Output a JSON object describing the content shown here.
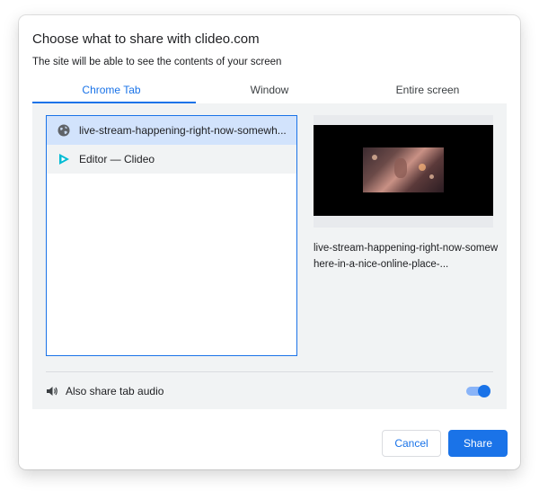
{
  "dialog": {
    "title": "Choose what to share with clideo.com",
    "subtitle": "The site will be able to see the contents of your screen"
  },
  "tabs": [
    {
      "label": "Chrome Tab",
      "selected": true
    },
    {
      "label": "Window",
      "selected": false
    },
    {
      "label": "Entire screen",
      "selected": false
    }
  ],
  "sources": [
    {
      "label": "live-stream-happening-right-now-somewh...",
      "icon": "globe-icon",
      "selected": true
    },
    {
      "label": "Editor — Clideo",
      "icon": "clideo-play-icon",
      "selected": false
    }
  ],
  "preview": {
    "caption": "live-stream-happening-right-now-somewhere-in-a-nice-online-place-..."
  },
  "audio": {
    "label": "Also share tab audio",
    "enabled": true
  },
  "buttons": {
    "cancel": "Cancel",
    "share": "Share"
  },
  "colors": {
    "accent": "#1a73e8",
    "selected_row": "#d2e3fc",
    "panel_bg": "#f1f3f4"
  }
}
